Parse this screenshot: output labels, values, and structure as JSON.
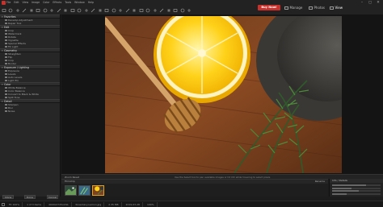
{
  "menu": [
    "File",
    "Edit",
    "View",
    "Image",
    "Color",
    "Effects",
    "Tools",
    "Window",
    "Help"
  ],
  "header": {
    "buy_now": "Buy Now!",
    "tabs": [
      {
        "label": "Manage",
        "icon": "manage-icon"
      },
      {
        "label": "Photos",
        "icon": "photos-icon"
      },
      {
        "label": "View",
        "icon": "view-icon"
      }
    ]
  },
  "toolbar_icons": [
    "open-icon",
    "save-icon",
    "undo-icon",
    "redo-icon",
    "crop-icon",
    "rotate-left-icon",
    "rotate-right-icon",
    "zoom-in-icon",
    "zoom-out-icon",
    "fit-icon",
    "actual-size-icon",
    "compare-icon",
    "brush-icon",
    "eraser-icon",
    "text-icon",
    "shape-icon",
    "gradient-icon",
    "clone-icon",
    "heal-icon",
    "red-eye-icon",
    "select-icon",
    "lasso-icon",
    "wand-icon",
    "hand-icon",
    "eyedropper-icon",
    "levels-icon",
    "curves-icon",
    "settings-icon"
  ],
  "left_panel": {
    "groups": [
      {
        "title": "Favorites",
        "items": [
          "Develop Adjustment",
          "Repair Tool"
        ]
      },
      {
        "title": "Edit",
        "items": [
          "Crop",
          "Watermark",
          "Rotate",
          "Vignette",
          "Special Effects",
          "Fill Light"
        ]
      },
      {
        "title": "Geometry",
        "items": [
          "Straighten",
          "Flip",
          "Crop",
          "Border"
        ]
      },
      {
        "title": "Exposure / Lighting",
        "items": [
          "Exposure",
          "Levels",
          "Auto Levels",
          "Light EQ"
        ]
      },
      {
        "title": "Color",
        "items": [
          "White Balance",
          "Color Balance",
          "Convert to Black & White",
          "Split Tone"
        ]
      },
      {
        "title": "Detail",
        "items": [
          "Sharpen",
          "Blur",
          "Noise"
        ]
      }
    ],
    "bottom_buttons": [
      "Clone",
      "Done",
      "Cancel"
    ]
  },
  "info_bar": {
    "left": "Zoom Reset",
    "center": "Use the Select tool to pan available images or hit Ctrl while hovering to select pixels"
  },
  "filmstrip": {
    "label_left": "Filmstrip",
    "label_right": "Rename",
    "thumbs": [
      {
        "name": "thumb-herbs",
        "selected": false
      },
      {
        "name": "thumb-rosemary",
        "selected": false
      },
      {
        "name": "thumb-lemon",
        "selected": true
      }
    ]
  },
  "right_mini": {
    "title": "Info / Details",
    "bars": [
      0.7,
      0.4,
      0.55,
      0.3
    ]
  },
  "status": [
    "Fit 100%",
    "1 of 3 items",
    "4000x2725x24b",
    "Rosemary-Lemon.jpg",
    "2.35 MB",
    "2019-03-28",
    "100%"
  ],
  "colors": {
    "accent": "#c8322c",
    "selection": "#e0a020"
  }
}
